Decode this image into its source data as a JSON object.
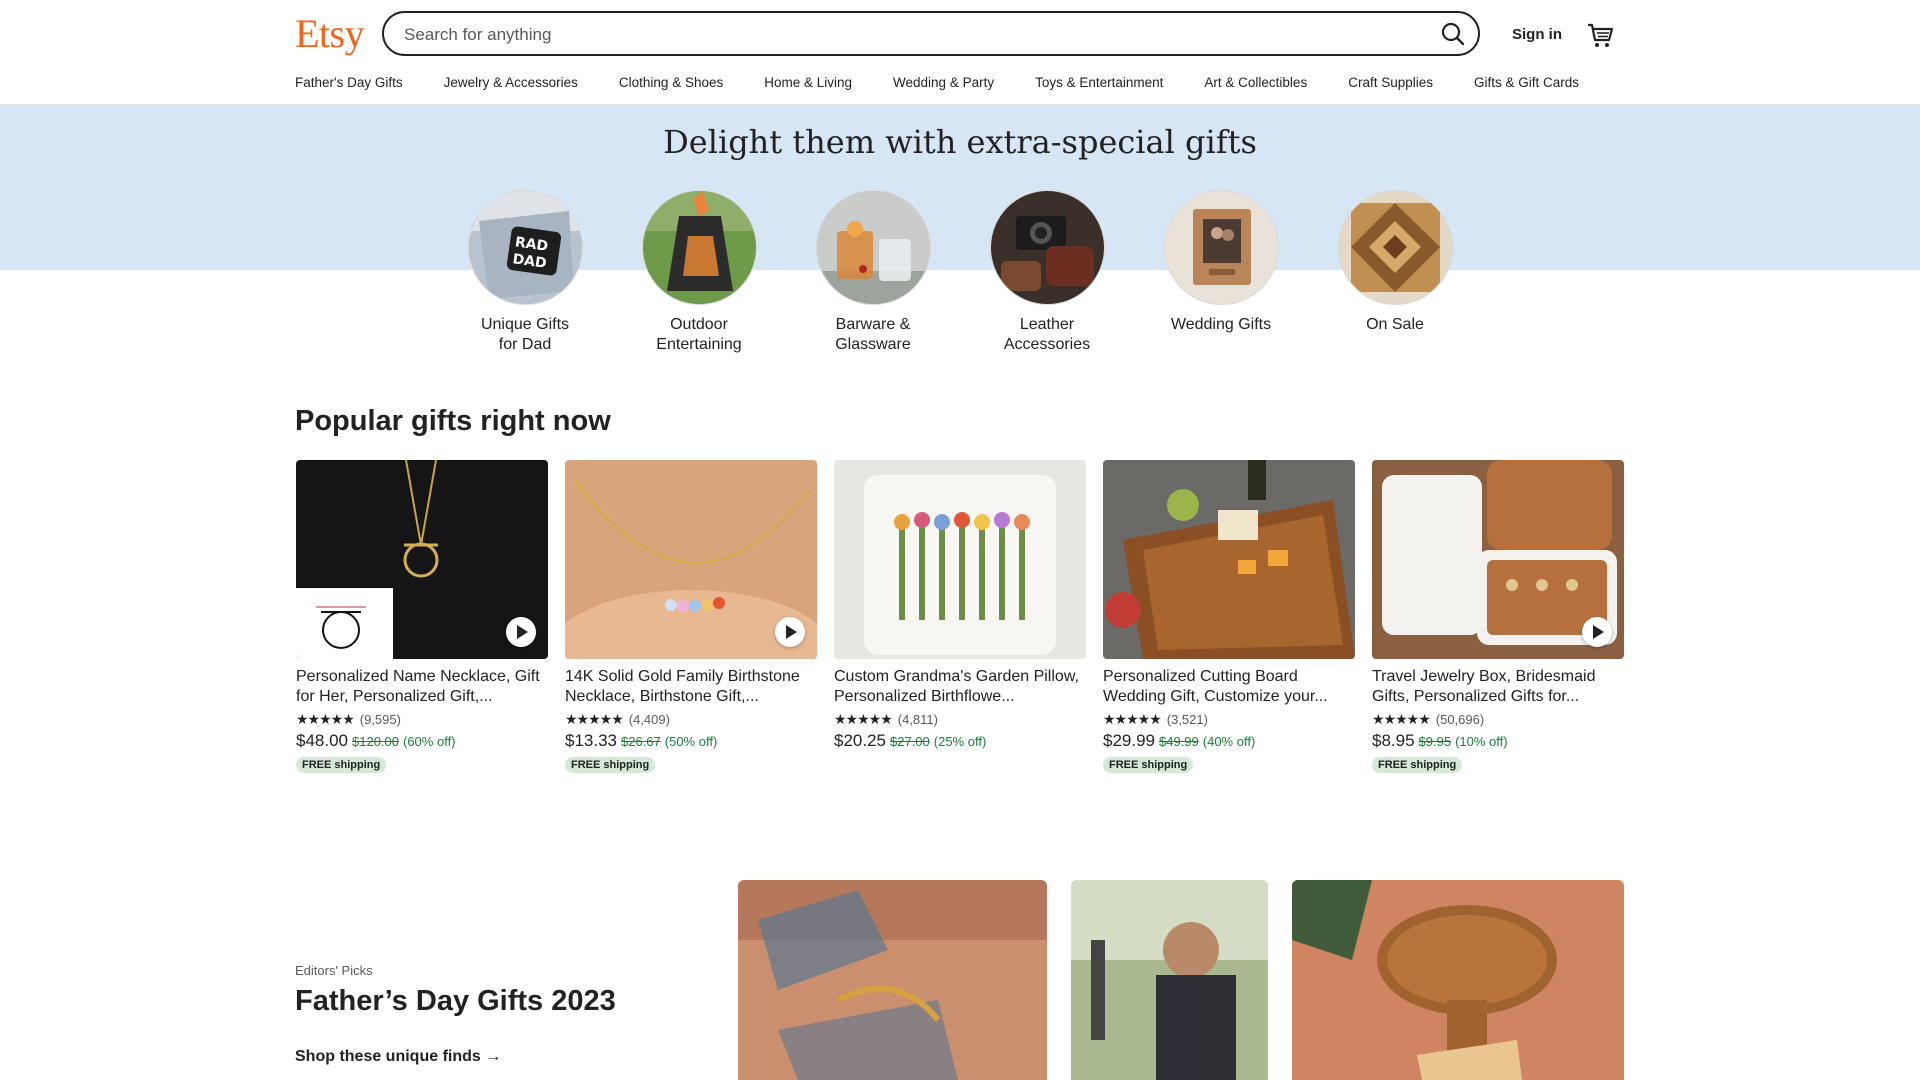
{
  "header": {
    "logo": "Etsy",
    "search_placeholder": "Search for anything",
    "signin_label": "Sign in"
  },
  "nav": [
    "Father's Day Gifts",
    "Jewelry & Accessories",
    "Clothing & Shoes",
    "Home & Living",
    "Wedding & Party",
    "Toys & Entertainment",
    "Art & Collectibles",
    "Craft Supplies",
    "Gifts & Gift Cards"
  ],
  "banner": {
    "title": "Delight them with extra-special gifts",
    "categories": [
      {
        "line1": "Unique Gifts",
        "line2": "for Dad"
      },
      {
        "line1": "Outdoor",
        "line2": "Entertaining"
      },
      {
        "line1": "Barware &",
        "line2": "Glassware"
      },
      {
        "line1": "Leather",
        "line2": "Accessories"
      },
      {
        "line1": "Wedding Gifts",
        "line2": ""
      },
      {
        "line1": "On Sale",
        "line2": ""
      }
    ]
  },
  "popular": {
    "title": "Popular gifts right now",
    "items": [
      {
        "title": "Personalized Name Necklace, Gift for Her, Personalized Gift,...",
        "stars": "★★★★★",
        "count": "(9,595)",
        "price": "$48.00",
        "orig": "$120.00",
        "off": "(60% off)",
        "badge": "FREE shipping"
      },
      {
        "title": "14K Solid Gold Family Birthstone Necklace, Birthstone Gift,...",
        "stars": "★★★★★",
        "count": "(4,409)",
        "price": "$13.33",
        "orig": "$26.67",
        "off": "(50% off)",
        "badge": "FREE shipping"
      },
      {
        "title": "Custom Grandma's Garden Pillow, Personalized Birthflowe...",
        "stars": "★★★★★",
        "count": "(4,811)",
        "price": "$20.25",
        "orig": "$27.00",
        "off": "(25% off)",
        "badge": ""
      },
      {
        "title": "Personalized Cutting Board Wedding Gift, Customize your...",
        "stars": "★★★★★",
        "count": "(3,521)",
        "price": "$29.99",
        "orig": "$49.99",
        "off": "(40% off)",
        "badge": "FREE shipping"
      },
      {
        "title": "Travel Jewelry Box, Bridesmaid Gifts, Personalized Gifts for...",
        "stars": "★★★★★",
        "count": "(50,696)",
        "price": "$8.95",
        "orig": "$9.95",
        "off": "(10% off)",
        "badge": "FREE shipping"
      }
    ]
  },
  "editors": {
    "label": "Editors' Picks",
    "title": "Father’s Day Gifts 2023",
    "link": "Shop these unique finds"
  },
  "colors": {
    "brand": "#F1641E",
    "banner": "#D7E6F5",
    "sale": "#1B7D3B",
    "badge": "#d4e9d7"
  }
}
